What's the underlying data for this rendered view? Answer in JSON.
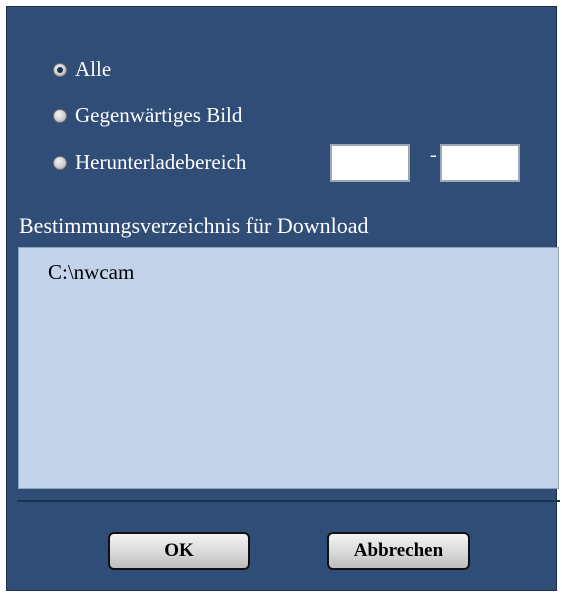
{
  "download_options": {
    "selected": "all",
    "options": [
      {
        "id": "all",
        "label": "Alle"
      },
      {
        "id": "current",
        "label": "Gegenwärtiges Bild"
      },
      {
        "id": "range",
        "label": "Herunterladebereich"
      }
    ],
    "range_from": "",
    "range_to": "",
    "range_separator": "-"
  },
  "destination": {
    "label": "Bestimmungsverzeichnis für Download",
    "path": "C:\\nwcam"
  },
  "buttons": {
    "ok_label": "OK",
    "cancel_label": "Abbrechen"
  },
  "colors": {
    "dialog_background": "#2f4d76",
    "destination_box": "#c3d4ea"
  }
}
